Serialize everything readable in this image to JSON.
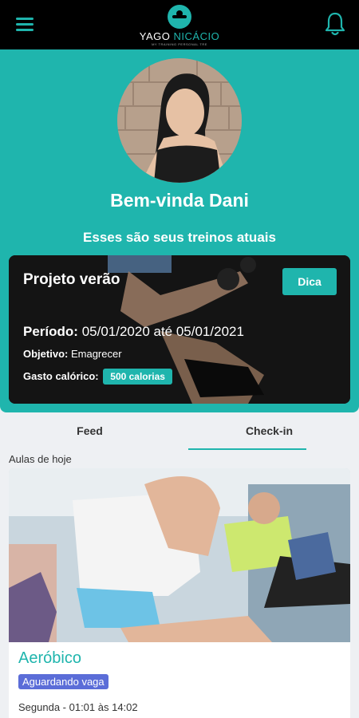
{
  "header": {
    "logo": {
      "name_primary": "YAGO",
      "name_accent": "NICÁCIO",
      "tagline": "MY TRAINING PERSONAL TRE"
    },
    "menu_icon": "hamburger-menu-icon",
    "notification_icon": "bell-icon"
  },
  "profile": {
    "greeting": "Bem-vinda Dani",
    "subtitle": "Esses são seus treinos atuais"
  },
  "workout": {
    "title": "Projeto verão",
    "tip_button": "Dica",
    "period_label": "Período:",
    "period_value": "05/01/2020 até 05/01/2021",
    "objective_label": "Objetivo:",
    "objective_value": "Emagrecer",
    "calories_label": "Gasto calórico:",
    "calories_value": "500 calorias"
  },
  "tabs": [
    {
      "label": "Feed",
      "active": false
    },
    {
      "label": "Check-in",
      "active": true
    }
  ],
  "today": {
    "section_label": "Aulas de hoje",
    "classes": [
      {
        "name": "Aeróbico",
        "status": "Aguardando vaga",
        "schedule": "Segunda - 01:01 às 14:02"
      }
    ]
  },
  "colors": {
    "accent": "#1fb5ad",
    "topbar": "#000000",
    "status_badge": "#5b6dd8",
    "background": "#eef0f3"
  }
}
